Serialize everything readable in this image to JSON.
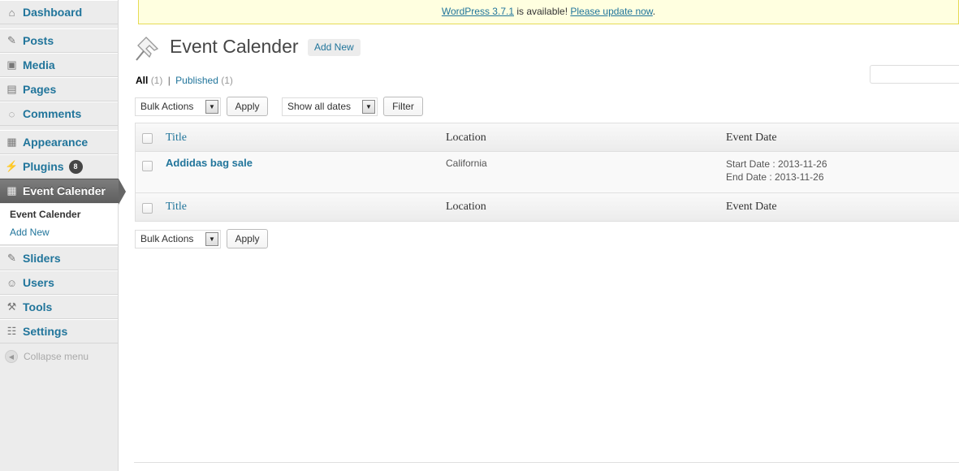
{
  "sidebar": {
    "items": [
      {
        "label": "Dashboard",
        "icon": "dashboard-icon",
        "glyph": "⌂"
      },
      {
        "label": "Posts",
        "icon": "pin-icon",
        "glyph": "✎"
      },
      {
        "label": "Media",
        "icon": "media-icon",
        "glyph": "▣"
      },
      {
        "label": "Pages",
        "icon": "pages-icon",
        "glyph": "▤"
      },
      {
        "label": "Comments",
        "icon": "comments-icon",
        "glyph": "◌"
      },
      {
        "label": "Appearance",
        "icon": "appearance-icon",
        "glyph": "▦"
      },
      {
        "label": "Plugins",
        "icon": "plugins-icon",
        "glyph": "⚡",
        "badge": "8"
      },
      {
        "label": "Event Calender",
        "icon": "calendar-icon",
        "glyph": "▦"
      },
      {
        "label": "Sliders",
        "icon": "pin-icon",
        "glyph": "✎"
      },
      {
        "label": "Users",
        "icon": "users-icon",
        "glyph": "☺"
      },
      {
        "label": "Tools",
        "icon": "tools-icon",
        "glyph": "⚒"
      },
      {
        "label": "Settings",
        "icon": "settings-icon",
        "glyph": "☷"
      }
    ],
    "submenu": [
      {
        "label": "Event Calender"
      },
      {
        "label": "Add New"
      }
    ],
    "collapse_label": "Collapse menu"
  },
  "notice": {
    "link1": "WordPress 3.7.1",
    "text": " is available! ",
    "link2": "Please update now",
    "end": "."
  },
  "header": {
    "title": "Event Calender",
    "add_new": "Add New"
  },
  "filters": {
    "all_label": "All",
    "all_count": "(1)",
    "separator": "|",
    "published_label": "Published",
    "published_count": "(1)"
  },
  "toolbar": {
    "bulk_actions": "Bulk Actions",
    "apply": "Apply",
    "dates": "Show all dates",
    "filter": "Filter"
  },
  "table": {
    "columns": [
      "Title",
      "Location",
      "Event Date"
    ],
    "rows": [
      {
        "title": "Addidas bag sale",
        "location": "California",
        "start_date": "Start Date : 2013-11-26",
        "end_date": "End Date : 2013-11-26"
      }
    ]
  },
  "colors": {
    "link": "#21759b",
    "sidebar_bg": "#ececec",
    "current_menu": "#6a6a6a",
    "notice_bg": "#ffffe0"
  }
}
